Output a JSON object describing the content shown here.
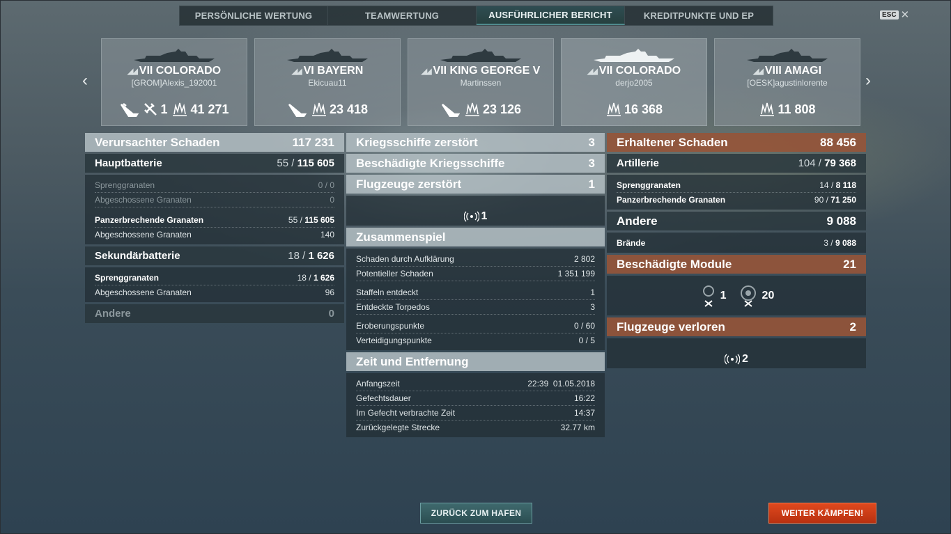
{
  "tabs": [
    "PERSÖNLICHE WERTUNG",
    "TEAMWERTUNG",
    "AUSFÜHRLICHER BERICHT",
    "KREDITPUNKTE UND EP"
  ],
  "esc": {
    "key": "ESC",
    "close": "✕"
  },
  "nav": {
    "prev": "‹",
    "next": "›"
  },
  "ships": [
    {
      "tier_name": "VII COLORADO",
      "player": "[GROM]Alexis_192001",
      "stats": [
        {
          "icon": "ship-sunk-icon",
          "value": ""
        },
        {
          "icon": "plane-shot-icon",
          "value": "1"
        },
        {
          "icon": "damage-burst-icon",
          "value": "41 271"
        }
      ]
    },
    {
      "tier_name": "VI BAYERN",
      "player": "Ekicuau11",
      "stats": [
        {
          "icon": "ship-sunk-icon",
          "value": ""
        },
        {
          "icon": "damage-burst-icon",
          "value": "23 418"
        }
      ]
    },
    {
      "tier_name": "VII KING GEORGE V",
      "player": "Martinssen",
      "stats": [
        {
          "icon": "ship-sunk-icon",
          "value": ""
        },
        {
          "icon": "damage-burst-icon",
          "value": "23 126"
        }
      ]
    },
    {
      "tier_name": "VII COLORADO",
      "player": "derjo2005",
      "stats": [
        {
          "icon": "damage-burst-icon",
          "value": "16 368"
        }
      ]
    },
    {
      "tier_name": "VIII AMAGI",
      "player": "[OESK]agustinlorente",
      "stats": [
        {
          "icon": "damage-burst-icon",
          "value": "11 808"
        }
      ]
    }
  ],
  "left": {
    "title": "Verursachter Schaden",
    "total": "117 231",
    "main": {
      "label": "Hauptbatterie",
      "hits": "55",
      "sep": " / ",
      "value": "115 605",
      "rows1": [
        {
          "label": "Sprenggranaten",
          "value": "0 / 0"
        },
        {
          "label": "Abgeschossene Granaten",
          "value": "0"
        }
      ],
      "rows2": [
        {
          "label": "Panzerbrechende Granaten",
          "hits": "55",
          "value": "115 605"
        },
        {
          "label": "Abgeschossene Granaten",
          "value": "140"
        }
      ]
    },
    "secondary": {
      "label": "Sekundärbatterie",
      "hits": "18",
      "value": "1 626",
      "rows": [
        {
          "label": "Sprenggranaten",
          "hits": "18",
          "value": "1 626"
        },
        {
          "label": "Abgeschossene Granaten",
          "value": "96"
        }
      ]
    },
    "other": {
      "label": "Andere",
      "value": "0"
    }
  },
  "middle": {
    "destroyed": {
      "label": "Kriegsschiffe zerstört",
      "value": "3"
    },
    "damaged": {
      "label": "Beschädigte Kriegsschiffe",
      "value": "3"
    },
    "planes": {
      "label": "Flugzeuge zerstört",
      "value": "1",
      "icon_count": "1"
    },
    "team": {
      "label": "Zusammenspiel",
      "rows": [
        [
          {
            "label": "Schaden durch Aufklärung",
            "value": "2 802"
          },
          {
            "label": "Potentieller Schaden",
            "value": "1 351 199"
          }
        ],
        [
          {
            "label": "Staffeln entdeckt",
            "value": "1"
          },
          {
            "label": "Entdeckte Torpedos",
            "value": "3"
          }
        ],
        [
          {
            "label": "Eroberungspunkte",
            "value": "0 / 60"
          },
          {
            "label": "Verteidigungspunkte",
            "value": "0 / 5"
          }
        ]
      ]
    },
    "time": {
      "label": "Zeit und Entfernung",
      "rows": [
        {
          "label": "Anfangszeit",
          "value": "22:39  01.05.2018"
        },
        {
          "label": "Gefechtsdauer",
          "value": "16:22"
        },
        {
          "label": "Im Gefecht verbrachte Zeit",
          "value": "14:37"
        },
        {
          "label": "Zurückgelegte Strecke",
          "value": "32.77 km"
        }
      ]
    }
  },
  "right": {
    "received": {
      "label": "Erhaltener Schaden",
      "value": "88 456"
    },
    "artillery": {
      "label": "Artillerie",
      "hits": "104",
      "value": "79 368",
      "rows": [
        {
          "label": "Sprenggranaten",
          "hits": "14",
          "value": "8 118"
        },
        {
          "label": "Panzerbrechende Granaten",
          "hits": "90",
          "value": "71 250"
        }
      ]
    },
    "other": {
      "label": "Andere",
      "value": "9 088",
      "rows": [
        {
          "label": "Brände",
          "hits": "3",
          "value": "9 088"
        }
      ]
    },
    "modules": {
      "label": "Beschädigte Module",
      "value": "21",
      "items": [
        {
          "icon": "steering-gear-icon",
          "count": "1"
        },
        {
          "icon": "engine-module-icon",
          "count": "20"
        }
      ]
    },
    "planes_lost": {
      "label": "Flugzeuge verloren",
      "value": "2",
      "icon_count": "2"
    }
  },
  "buttons": {
    "home": "ZURÜCK ZUM HAFEN",
    "fight": "WEITER KÄMPFEN!"
  },
  "colors": {
    "accent_rust": "#965438",
    "fight_button": "#d23d16",
    "home_button": "#34585c"
  }
}
